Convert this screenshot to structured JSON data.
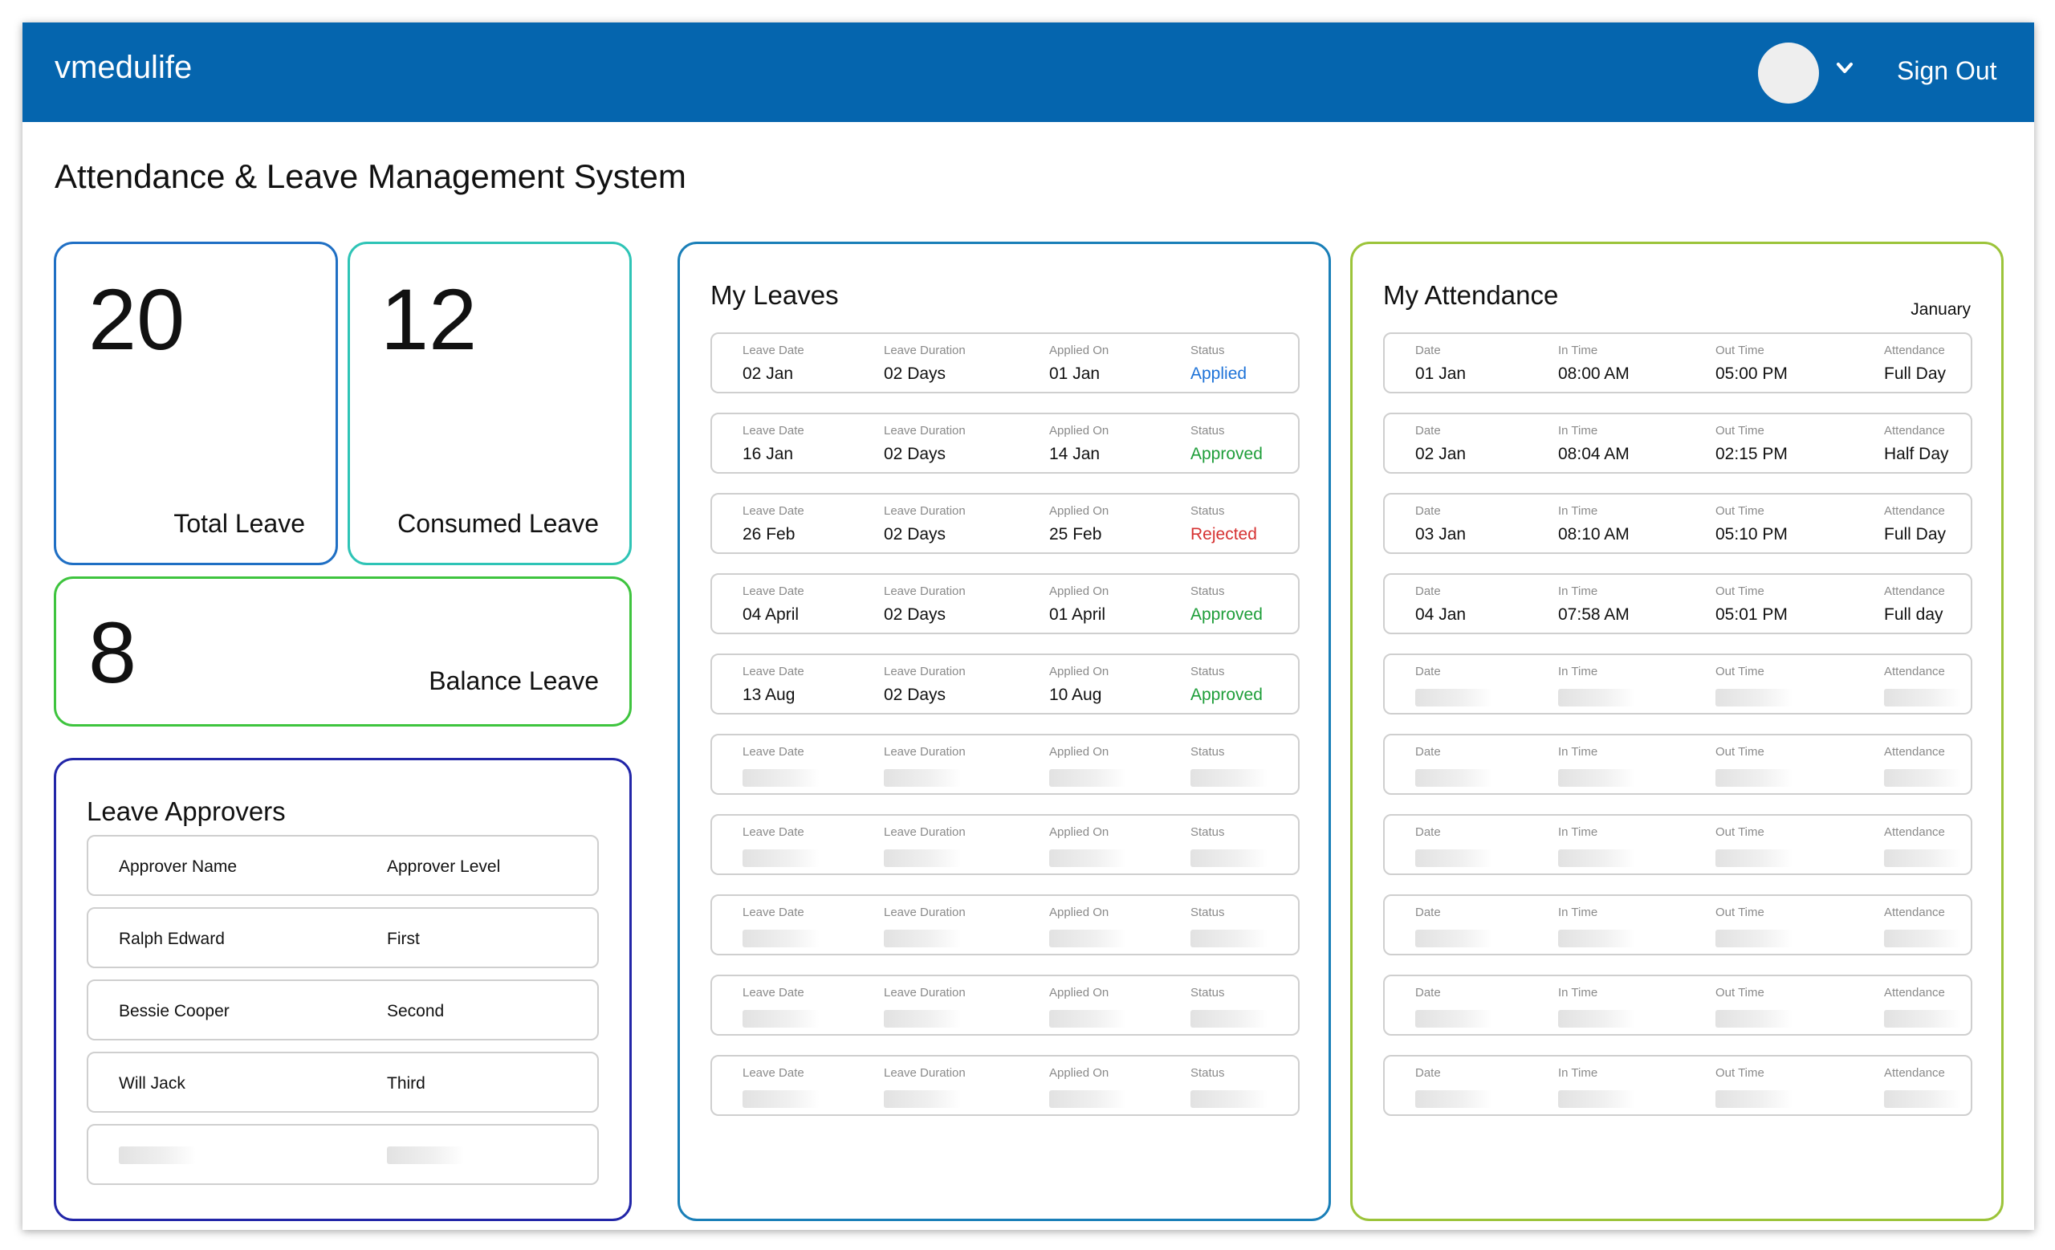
{
  "app": {
    "brand": "vmedulife",
    "sign_out": "Sign Out"
  },
  "page": {
    "title": "Attendance & Leave Management System"
  },
  "stats": {
    "total": {
      "value": "20",
      "label": "Total Leave"
    },
    "consumed": {
      "value": "12",
      "label": "Consumed Leave"
    },
    "balance": {
      "value": "8",
      "label": "Balance Leave"
    }
  },
  "approvers": {
    "title": "Leave Approvers",
    "headers": [
      "Approver Name",
      "Approver Level"
    ],
    "rows": [
      {
        "name": "Ralph Edward",
        "level": "First"
      },
      {
        "name": "Bessie Cooper",
        "level": "Second"
      },
      {
        "name": "Will Jack",
        "level": "Third"
      }
    ]
  },
  "leaves": {
    "title": "My Leaves",
    "headers": [
      "Leave Date",
      "Leave Duration",
      "Applied On",
      "Status"
    ],
    "rows": [
      {
        "date": "02 Jan",
        "duration": "02 Days",
        "applied": "01 Jan",
        "status": "Applied"
      },
      {
        "date": "16 Jan",
        "duration": "02 Days",
        "applied": "14 Jan",
        "status": "Approved"
      },
      {
        "date": "26 Feb",
        "duration": "02 Days",
        "applied": "25 Feb",
        "status": "Rejected"
      },
      {
        "date": "04 April",
        "duration": "02 Days",
        "applied": "01 April",
        "status": "Approved"
      },
      {
        "date": "13 Aug",
        "duration": "02 Days",
        "applied": "10 Aug",
        "status": "Approved"
      }
    ]
  },
  "attendance": {
    "title": "My Attendance",
    "month": "January",
    "headers": [
      "Date",
      "In Time",
      "Out Time",
      "Attendance"
    ],
    "rows": [
      {
        "date": "01 Jan",
        "in": "08:00 AM",
        "out": "05:00 PM",
        "attendance": "Full Day"
      },
      {
        "date": "02 Jan",
        "in": "08:04 AM",
        "out": "02:15 PM",
        "attendance": "Half Day"
      },
      {
        "date": "03 Jan",
        "in": "08:10 AM",
        "out": "05:10 PM",
        "attendance": "Full Day"
      },
      {
        "date": "04 Jan",
        "in": "07:58 AM",
        "out": "05:01 PM",
        "attendance": "Full day"
      }
    ]
  },
  "colors": {
    "header": "#0565ae",
    "total_border": "#1f6fc4",
    "consumed_border": "#2ec4b6",
    "balance_border": "#3ec43e",
    "approvers_border": "#2226a8",
    "leaves_border": "#1a7fb8",
    "attendance_border": "#9cc43a",
    "status_applied": "#1e73d8",
    "status_approved": "#1f9e3a",
    "status_rejected": "#d63232"
  },
  "icons": {
    "avatar": "user-avatar-icon",
    "dropdown": "chevron-down-icon"
  }
}
